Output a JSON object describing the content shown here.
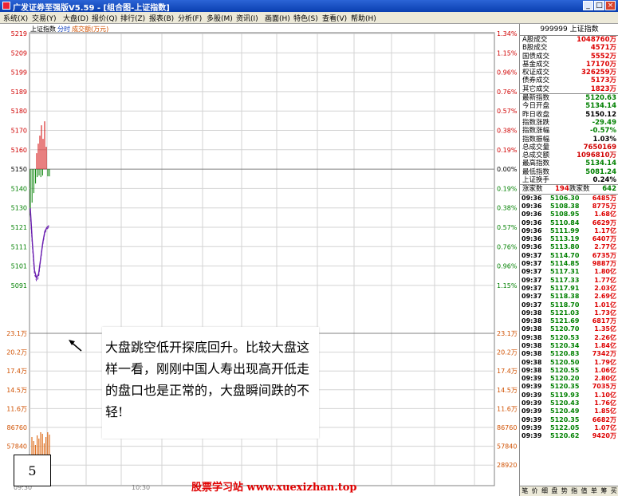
{
  "window": {
    "title": "广发证券至强版V5.59 - [组合图-上证指数]"
  },
  "menu": [
    "系统(X)",
    "交易(Y)",
    "大盘(D)",
    "报价(Q)",
    "排行(Z)",
    "报表(B)",
    "分析(F)",
    "多股(M)",
    "资讯(I)",
    "画面(H)",
    "特色(S)",
    "查看(V)",
    "帮助(H)"
  ],
  "chart_header": {
    "name": "上证指数",
    "tab": "分时",
    "series": "成交额(万元)"
  },
  "chart_data": {
    "type": "line",
    "price_axis_left": [
      "5219",
      "5209",
      "5199",
      "5189",
      "5180",
      "5170",
      "5160",
      "5150",
      "5140",
      "5130",
      "5121",
      "5111",
      "5101",
      "5091"
    ],
    "pct_axis_right": [
      "1.34%",
      "1.15%",
      "0.96%",
      "0.76%",
      "0.57%",
      "0.38%",
      "0.19%",
      "0.00%",
      "0.19%",
      "0.38%",
      "0.57%",
      "0.76%",
      "0.96%",
      "1.15%"
    ],
    "volume_axis_left": [
      "23.1万",
      "20.2万",
      "17.4万",
      "14.5万",
      "11.6万",
      "86760",
      "57840",
      "2"
    ],
    "volume_axis_right": [
      "23.1万",
      "20.2万",
      "17.4万",
      "14.5万",
      "11.6万",
      "86760",
      "57840",
      "28920"
    ],
    "time_labels": [
      "09:30",
      "10:30"
    ],
    "reference": 5150.12,
    "ylim": [
      5086,
      5224
    ],
    "price_series": [
      5130,
      5112,
      5098,
      5094,
      5096,
      5104,
      5112,
      5118,
      5120,
      5121
    ]
  },
  "right_panel": {
    "title": "999999 上证指数",
    "stats_top": [
      {
        "label": "A股成交",
        "value": "1048760万"
      },
      {
        "label": "B股成交",
        "value": "4571万"
      },
      {
        "label": "国债成交",
        "value": "5552万"
      },
      {
        "label": "基金成交",
        "value": "17170万"
      },
      {
        "label": "权证成交",
        "value": "326259万"
      },
      {
        "label": "债券成交",
        "value": "5173万"
      },
      {
        "label": "其它成交",
        "value": "1823万"
      }
    ],
    "stats_mid": [
      {
        "label": "最新指数",
        "value": "5120.63",
        "color": "#008000"
      },
      {
        "label": "今日开盘",
        "value": "5134.14",
        "color": "#008000"
      },
      {
        "label": "昨日收盘",
        "value": "5150.12",
        "color": "#000000"
      },
      {
        "label": "指数涨跌",
        "value": "-29.49",
        "color": "#008000"
      },
      {
        "label": "指数涨幅",
        "value": "-0.57%",
        "color": "#008000"
      },
      {
        "label": "指数振幅",
        "value": "1.03%",
        "color": "#000000"
      },
      {
        "label": "总成交量",
        "value": "7650169",
        "color": "#d00000"
      },
      {
        "label": "总成交额",
        "value": "1096810万",
        "color": "#d00000"
      },
      {
        "label": "最高指数",
        "value": "5134.14",
        "color": "#008000"
      },
      {
        "label": "最低指数",
        "value": "5081.24",
        "color": "#008000"
      },
      {
        "label": "上证换手",
        "value": "0.24%",
        "color": "#000000"
      }
    ],
    "updown": {
      "up_label": "涨家数",
      "up": "194",
      "down_label": "跌家数",
      "down": "642"
    },
    "ticks": [
      [
        "09:36",
        "5106.30",
        "6485万"
      ],
      [
        "09:36",
        "5108.38",
        "8775万"
      ],
      [
        "09:36",
        "5108.95",
        "1.68亿"
      ],
      [
        "09:36",
        "5110.84",
        "6629万"
      ],
      [
        "09:36",
        "5111.99",
        "1.17亿"
      ],
      [
        "09:36",
        "5113.19",
        "6407万"
      ],
      [
        "09:36",
        "5113.80",
        "2.77亿"
      ],
      [
        "09:37",
        "5114.70",
        "6735万"
      ],
      [
        "09:37",
        "5114.85",
        "9887万"
      ],
      [
        "09:37",
        "5117.31",
        "1.80亿"
      ],
      [
        "09:37",
        "5117.33",
        "1.77亿"
      ],
      [
        "09:37",
        "5117.91",
        "2.03亿"
      ],
      [
        "09:37",
        "5118.38",
        "2.69亿"
      ],
      [
        "09:37",
        "5118.70",
        "1.01亿"
      ],
      [
        "09:38",
        "5121.03",
        "1.73亿"
      ],
      [
        "09:38",
        "5121.69",
        "6817万"
      ],
      [
        "09:38",
        "5120.70",
        "1.35亿"
      ],
      [
        "09:38",
        "5120.53",
        "2.26亿"
      ],
      [
        "09:38",
        "5120.34",
        "1.84亿"
      ],
      [
        "09:38",
        "5120.83",
        "7342万"
      ],
      [
        "09:38",
        "5120.50",
        "1.79亿"
      ],
      [
        "09:38",
        "5120.55",
        "1.06亿"
      ],
      [
        "09:39",
        "5120.20",
        "2.80亿"
      ],
      [
        "09:39",
        "5120.35",
        "7035万"
      ],
      [
        "09:39",
        "5119.93",
        "1.10亿"
      ],
      [
        "09:39",
        "5120.43",
        "1.76亿"
      ],
      [
        "09:39",
        "5120.49",
        "1.85亿"
      ],
      [
        "09:39",
        "5120.35",
        "6682万"
      ],
      [
        "09:39",
        "5122.05",
        "1.07亿"
      ],
      [
        "09:39",
        "5120.62",
        "9420万"
      ]
    ],
    "tabs": [
      "笔",
      "价",
      "细",
      "盘",
      "势",
      "指",
      "值",
      "单",
      "筹",
      "买"
    ]
  },
  "annotation": {
    "text": "大盘跳空低开探底回升。比较大盘这样一看，刚刚中国人寿出现高开低走的盘口也是正常的，大盘瞬间跌的不轻!",
    "number": "5"
  },
  "watermark": "股票学习站 www.xuexizhan.top",
  "colors": {
    "up": "#d00000",
    "down": "#008000",
    "grid": "#d3d3d3",
    "ref_line": "#808080"
  }
}
